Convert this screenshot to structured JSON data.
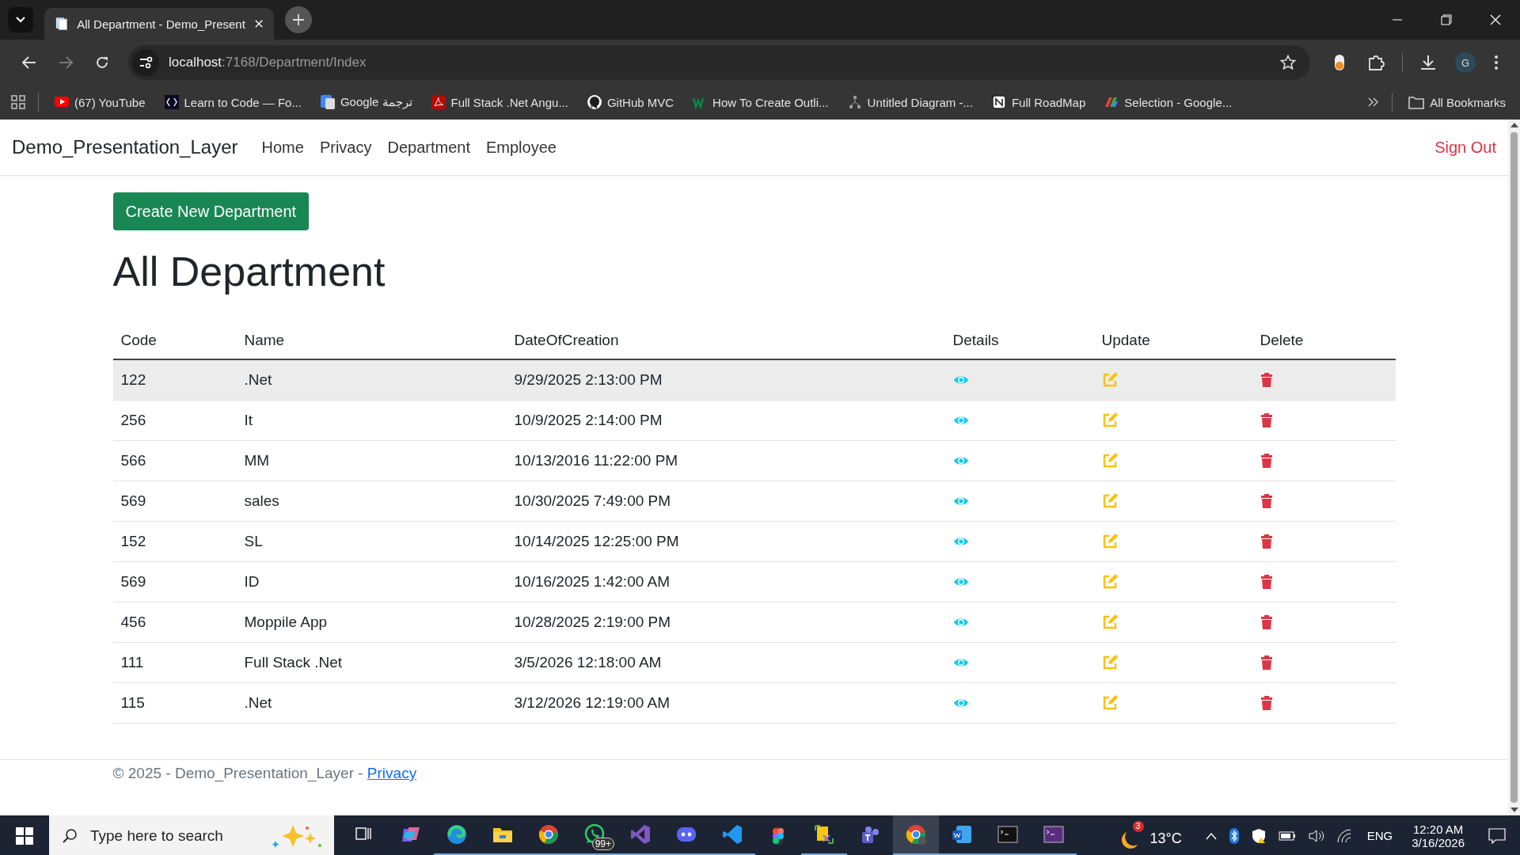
{
  "browser": {
    "tab_title": "All Department - Demo_Present",
    "url_host": "localhost",
    "url_path": ":7168/Department/Index",
    "profile_initial": "G",
    "bookmarks": [
      {
        "label": "(67) YouTube"
      },
      {
        "label": "Learn to Code — Fo..."
      },
      {
        "label": "Google ترجمة"
      },
      {
        "label": "Full Stack .Net Angu..."
      },
      {
        "label": "GitHub MVC"
      },
      {
        "label": "How To Create Outli..."
      },
      {
        "label": "Untitled Diagram -..."
      },
      {
        "label": "Full RoadMap"
      },
      {
        "label": "Selection - Google..."
      }
    ],
    "all_bookmarks": "All Bookmarks"
  },
  "navbar": {
    "brand": "Demo_Presentation_Layer",
    "links": [
      "Home",
      "Privacy",
      "Department",
      "Employee"
    ],
    "sign_out": "Sign Out"
  },
  "create_button": "Create New Department",
  "heading": "All Department",
  "table": {
    "columns": [
      "Code",
      "Name",
      "DateOfCreation",
      "Details",
      "Update",
      "Delete"
    ],
    "rows": [
      {
        "code": "122",
        "name": ".Net",
        "date": "9/29/2025 2:13:00 PM",
        "hovered": true
      },
      {
        "code": "256",
        "name": "It",
        "date": "10/9/2025 2:14:00 PM",
        "hovered": false
      },
      {
        "code": "566",
        "name": "MM",
        "date": "10/13/2016 11:22:00 PM",
        "hovered": false
      },
      {
        "code": "569",
        "name": "sales",
        "date": "10/30/2025 7:49:00 PM",
        "hovered": false
      },
      {
        "code": "152",
        "name": "SL",
        "date": "10/14/2025 12:25:00 PM",
        "hovered": false
      },
      {
        "code": "569",
        "name": "ID",
        "date": "10/16/2025 1:42:00 AM",
        "hovered": false
      },
      {
        "code": "456",
        "name": "Moppile App",
        "date": "10/28/2025 2:19:00 PM",
        "hovered": false
      },
      {
        "code": "111",
        "name": "Full Stack .Net",
        "date": "3/5/2026 12:18:00 AM",
        "hovered": false
      },
      {
        "code": "115",
        "name": ".Net",
        "date": "3/12/2026 12:19:00 AM",
        "hovered": false
      }
    ]
  },
  "footer": {
    "text": "© 2025 - Demo_Presentation_Layer - ",
    "link": "Privacy"
  },
  "taskbar": {
    "search_placeholder": "Type here to search",
    "apps": [
      {
        "running": false,
        "active": false
      },
      {
        "running": false,
        "active": false
      },
      {
        "running": true,
        "active": false
      },
      {
        "running": true,
        "active": false
      },
      {
        "running": true,
        "active": false
      },
      {
        "running": true,
        "active": false,
        "badge": "99+"
      },
      {
        "running": true,
        "active": false
      },
      {
        "running": true,
        "active": false
      },
      {
        "running": true,
        "active": false
      },
      {
        "running": false,
        "active": false
      },
      {
        "running": true,
        "active": false
      },
      {
        "running": false,
        "active": false
      },
      {
        "running": true,
        "active": true
      },
      {
        "running": true,
        "active": false
      },
      {
        "running": true,
        "active": false
      },
      {
        "running": true,
        "active": false
      }
    ],
    "weather_badge": "3",
    "temperature": "13°C",
    "language": "ENG",
    "time": "12:20 AM",
    "date": "3/16/2026"
  }
}
